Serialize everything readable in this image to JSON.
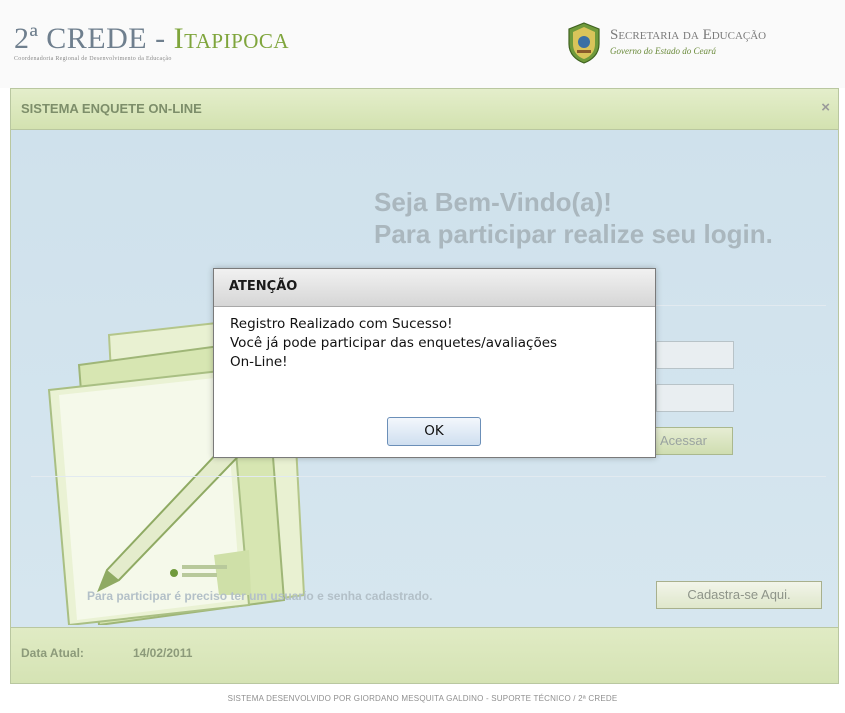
{
  "header": {
    "logo_prefix": "2ª CREDE - ",
    "logo_city": "Itapipoca",
    "logo_subtitle": "Coordenadoria Regional de Desenvolvimento da Educação",
    "secretaria_title": "Secretaria da Educação",
    "secretaria_subtitle": "Governo do Estado do Ceará"
  },
  "panel": {
    "title": "SISTEMA ENQUETE ON-LINE",
    "close_symbol": "×",
    "welcome_line1": "Seja Bem-Vindo(a)!",
    "welcome_line2": "Para participar realize seu login.",
    "acessar_label": "Acessar",
    "need_account_text": "Para participar é preciso ter um usuario e senha cadastrado.",
    "register_button": "Cadastra-se Aqui."
  },
  "footer": {
    "date_label": "Data Atual:",
    "date_value": "14/02/2011",
    "credits": "SISTEMA DESENVOLVIDO POR GIORDANO MESQUITA GALDINO - SUPORTE TÉCNICO / 2ª CREDE"
  },
  "modal": {
    "title": "ATENÇÃO",
    "line1": "Registro Realizado com Sucesso!",
    "line2": "Você já pode participar das enquetes/avaliações",
    "line3": "On-Line!",
    "ok_label": "OK"
  },
  "colors": {
    "accent_green": "#7fa53c",
    "panel_bg": "#cfe0e8",
    "titlebar_green": "#d3e2b0",
    "modal_button_border": "#6b8fb8"
  },
  "icons": {
    "seal": "ceara-state-seal-icon",
    "illustration": "notebook-pen-icon",
    "close": "close-icon"
  }
}
